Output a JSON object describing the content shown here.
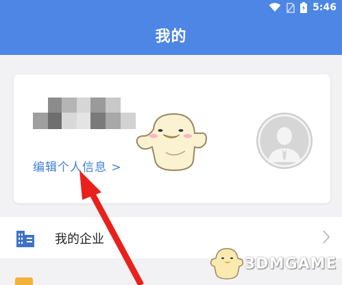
{
  "status_bar": {
    "time": "5:46"
  },
  "header": {
    "title": "我的"
  },
  "profile": {
    "edit_link": "编辑个人信息 >"
  },
  "menu": {
    "items": [
      {
        "label": "我的企业",
        "icon": "company-building-icon"
      }
    ]
  },
  "watermark": {
    "text": "3DMGAME"
  },
  "colors": {
    "header_bg": "#4d86e4",
    "link": "#3f7fd8",
    "page_bg": "#f2f2f4",
    "arrow": "#e8211c"
  }
}
